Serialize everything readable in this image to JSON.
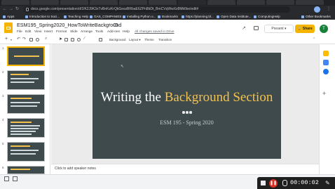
{
  "browser": {
    "url": "docs.google.com/presentation/d/1fK2J9K3xTvBnKzKrQkGessBRbaE6ZPn8bDt_BmCVqWwXz8Mk6ke/edit#",
    "bookmarks": [
      "Apps",
      "Introduction to Soci...",
      "Teaching Help",
      "GAS_COMPANIES",
      "Installing Python o...",
      "Bookmarks",
      "https://planning.bl...",
      "Open Data Institute...",
      "ComputingHelp",
      "Other Bookmarks"
    ]
  },
  "doc": {
    "title": "ESM195_Spring2020_HowToWriteBackground",
    "menu": [
      "File",
      "Edit",
      "View",
      "Insert",
      "Format",
      "Slide",
      "Arrange",
      "Tools",
      "Add-ons",
      "Help"
    ],
    "saved_status": "All changes saved in Drive",
    "present_label": "Present",
    "share_label": "Share",
    "avatar_initial": "T"
  },
  "toolbar": {
    "background": "Background",
    "layout": "Layout",
    "theme": "Theme",
    "transition": "Transition"
  },
  "slides": {
    "numbers": [
      "1",
      "2",
      "3",
      "4",
      "5",
      "6"
    ],
    "current": {
      "title_plain": "Writing the ",
      "title_accent": "Background Section",
      "subtitle": "ESM 195 - Spring 2020"
    }
  },
  "notes": {
    "placeholder": "Click to add speaker notes"
  },
  "recorder": {
    "time": "00:00:02"
  },
  "colors": {
    "slide_bg": "#3f4a4c",
    "accent": "#f2c14e",
    "share": "#f4b400"
  }
}
